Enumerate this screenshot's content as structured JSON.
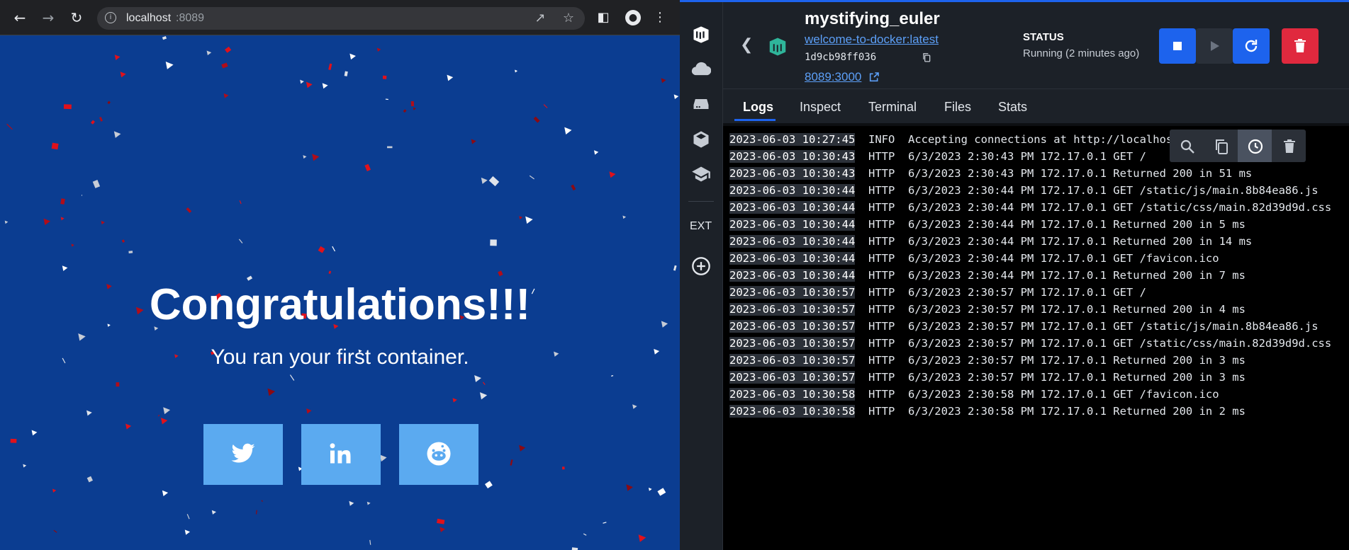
{
  "browser": {
    "url_host": "localhost",
    "url_port": ":8089",
    "headline": "Congratulations!!!",
    "subline": "You ran your first container.",
    "share_buttons": [
      "twitter",
      "linkedin",
      "reddit"
    ],
    "background_color": "#0b3d91",
    "button_color": "#5baaf0"
  },
  "docker": {
    "container_name": "mystifying_euler",
    "image": "welcome-to-docker:latest",
    "container_id": "1d9cb98ff036",
    "ports": "8089:3000",
    "status_title": "STATUS",
    "status_text": "Running (2 minutes ago)",
    "ext_label": "EXT",
    "tabs": [
      {
        "label": "Logs",
        "active": true
      },
      {
        "label": "Inspect",
        "active": false
      },
      {
        "label": "Terminal",
        "active": false
      },
      {
        "label": "Files",
        "active": false
      },
      {
        "label": "Stats",
        "active": false
      }
    ],
    "logs": [
      {
        "ts": "2023-06-03 10:27:45",
        "level": "INFO",
        "msg": "Accepting connections at http://localhost:3000"
      },
      {
        "ts": "2023-06-03 10:30:43",
        "level": "HTTP",
        "msg": "6/3/2023 2:30:43 PM 172.17.0.1 GET /"
      },
      {
        "ts": "2023-06-03 10:30:43",
        "level": "HTTP",
        "msg": "6/3/2023 2:30:43 PM 172.17.0.1 Returned 200 in 51 ms"
      },
      {
        "ts": "2023-06-03 10:30:44",
        "level": "HTTP",
        "msg": "6/3/2023 2:30:44 PM 172.17.0.1 GET /static/js/main.8b84ea86.js"
      },
      {
        "ts": "2023-06-03 10:30:44",
        "level": "HTTP",
        "msg": "6/3/2023 2:30:44 PM 172.17.0.1 GET /static/css/main.82d39d9d.css"
      },
      {
        "ts": "2023-06-03 10:30:44",
        "level": "HTTP",
        "msg": "6/3/2023 2:30:44 PM 172.17.0.1 Returned 200 in 5 ms"
      },
      {
        "ts": "2023-06-03 10:30:44",
        "level": "HTTP",
        "msg": "6/3/2023 2:30:44 PM 172.17.0.1 Returned 200 in 14 ms"
      },
      {
        "ts": "2023-06-03 10:30:44",
        "level": "HTTP",
        "msg": "6/3/2023 2:30:44 PM 172.17.0.1 GET /favicon.ico"
      },
      {
        "ts": "2023-06-03 10:30:44",
        "level": "HTTP",
        "msg": "6/3/2023 2:30:44 PM 172.17.0.1 Returned 200 in 7 ms"
      },
      {
        "ts": "2023-06-03 10:30:57",
        "level": "HTTP",
        "msg": "6/3/2023 2:30:57 PM 172.17.0.1 GET /"
      },
      {
        "ts": "2023-06-03 10:30:57",
        "level": "HTTP",
        "msg": "6/3/2023 2:30:57 PM 172.17.0.1 Returned 200 in 4 ms"
      },
      {
        "ts": "2023-06-03 10:30:57",
        "level": "HTTP",
        "msg": "6/3/2023 2:30:57 PM 172.17.0.1 GET /static/js/main.8b84ea86.js"
      },
      {
        "ts": "2023-06-03 10:30:57",
        "level": "HTTP",
        "msg": "6/3/2023 2:30:57 PM 172.17.0.1 GET /static/css/main.82d39d9d.css"
      },
      {
        "ts": "2023-06-03 10:30:57",
        "level": "HTTP",
        "msg": "6/3/2023 2:30:57 PM 172.17.0.1 Returned 200 in 3 ms"
      },
      {
        "ts": "2023-06-03 10:30:57",
        "level": "HTTP",
        "msg": "6/3/2023 2:30:57 PM 172.17.0.1 Returned 200 in 3 ms"
      },
      {
        "ts": "2023-06-03 10:30:58",
        "level": "HTTP",
        "msg": "6/3/2023 2:30:58 PM 172.17.0.1 GET /favicon.ico"
      },
      {
        "ts": "2023-06-03 10:30:58",
        "level": "HTTP",
        "msg": "6/3/2023 2:30:58 PM 172.17.0.1 Returned 200 in 2 ms"
      }
    ],
    "accent_color": "#1d63ed",
    "danger_color": "#e0293e"
  }
}
